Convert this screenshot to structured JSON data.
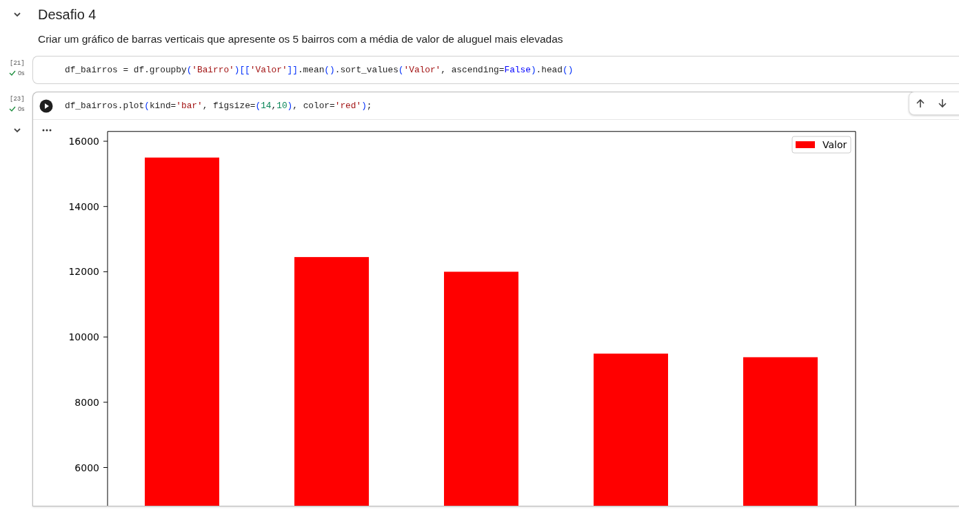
{
  "section": {
    "title": "Desafio 4",
    "expanded": true
  },
  "description": "Criar um gráfico de barras verticais que apresente os 5 bairros com a média de valor de aluguel mais elevadas",
  "cells": [
    {
      "exec_count": "[21]",
      "time": "0s",
      "success": true,
      "active": false,
      "tokens": [
        {
          "t": "df_bairros = df.groupby",
          "kind": "plain"
        },
        {
          "t": "(",
          "kind": "bracket"
        },
        {
          "t": "'Bairro'",
          "kind": "str"
        },
        {
          "t": ")[[",
          "kind": "bracket"
        },
        {
          "t": "'Valor'",
          "kind": "str"
        },
        {
          "t": "]]",
          "kind": "bracket"
        },
        {
          "t": ".mean",
          "kind": "plain"
        },
        {
          "t": "()",
          "kind": "bracket"
        },
        {
          "t": ".sort_values",
          "kind": "plain"
        },
        {
          "t": "(",
          "kind": "bracket"
        },
        {
          "t": "'Valor'",
          "kind": "str"
        },
        {
          "t": ", ascending=",
          "kind": "plain"
        },
        {
          "t": "False",
          "kind": "kw"
        },
        {
          "t": ")",
          "kind": "bracket"
        },
        {
          "t": ".head",
          "kind": "plain"
        },
        {
          "t": "()",
          "kind": "bracket"
        }
      ]
    },
    {
      "exec_count": "[23]",
      "time": "0s",
      "success": true,
      "active": true,
      "tokens": [
        {
          "t": "df_bairros.plot",
          "kind": "plain"
        },
        {
          "t": "(",
          "kind": "bracket"
        },
        {
          "t": "kind=",
          "kind": "plain"
        },
        {
          "t": "'bar'",
          "kind": "str"
        },
        {
          "t": ", figsize=",
          "kind": "plain"
        },
        {
          "t": "(",
          "kind": "bracket"
        },
        {
          "t": "14",
          "kind": "num"
        },
        {
          "t": ",",
          "kind": "plain"
        },
        {
          "t": "10",
          "kind": "num"
        },
        {
          "t": ")",
          "kind": "bracket"
        },
        {
          "t": ", color=",
          "kind": "plain"
        },
        {
          "t": "'red'",
          "kind": "str"
        },
        {
          "t": ")",
          "kind": "bracket"
        },
        {
          "t": ";",
          "kind": "plain"
        }
      ],
      "output": {
        "expanded": true,
        "chart_data": {
          "type": "bar",
          "ylim": [
            0,
            16300
          ],
          "yticks": [
            6000,
            8000,
            10000,
            12000,
            14000,
            16000
          ],
          "series": [
            {
              "name": "Valor",
              "color": "#ff0000",
              "values": [
                15500,
                12450,
                12000,
                9490,
                9380
              ]
            }
          ]
        }
      }
    }
  ]
}
